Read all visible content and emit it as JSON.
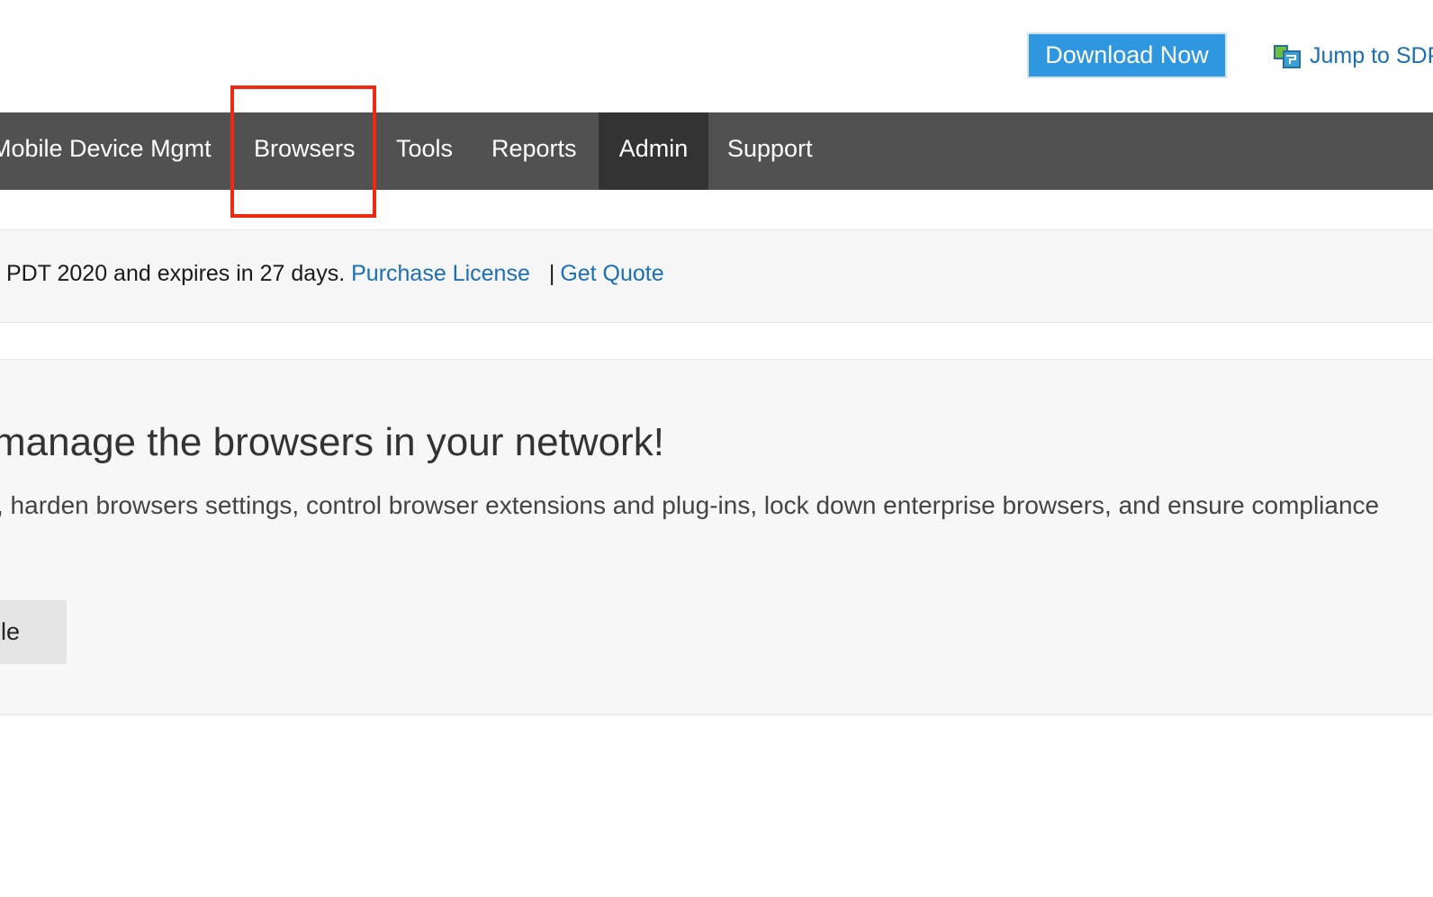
{
  "header": {
    "download_label": "Download Now",
    "jump_label": "Jump to SDP"
  },
  "nav": {
    "items": [
      {
        "label": "Mobile Device Mgmt"
      },
      {
        "label": "Browsers"
      },
      {
        "label": "Tools"
      },
      {
        "label": "Reports"
      },
      {
        "label": "Admin",
        "active": true
      },
      {
        "label": "Support"
      }
    ],
    "highlighted": "Browsers"
  },
  "license": {
    "text": "PDT 2020 and expires in 27 days.",
    "purchase_label": "Purchase License",
    "separator": "|",
    "quote_label": "Get Quote"
  },
  "promo": {
    "title": "manage the browsers in your network!",
    "description": ", harden browsers settings, control browser extensions and plug-ins, lock down enterprise browsers, and ensure compliance",
    "button_label": "Enable"
  },
  "colors": {
    "navbar": "#515151",
    "nav_active": "#333333",
    "download_button": "#2f96e0",
    "link": "#1a6fb5",
    "highlight_box": "#ee2a12"
  }
}
